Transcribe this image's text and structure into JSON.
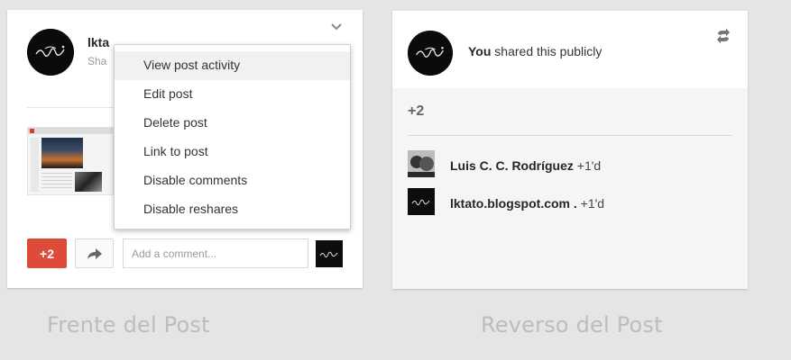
{
  "front": {
    "author_name": "lkta",
    "subtitle": "Sha",
    "menu_items": [
      "View post activity",
      "Edit post",
      "Delete post",
      "Link to post",
      "Disable comments",
      "Disable reshares"
    ],
    "plus_label": "+2",
    "comment_placeholder": "Add a comment..."
  },
  "back": {
    "shared_you": "You",
    "shared_rest": " shared this publicly",
    "plus_count": "+2",
    "plussers": [
      {
        "name": "Luis C. C. Rodríguez",
        "time": "+1'd"
      },
      {
        "name": "lktato.blogspot.com .",
        "time": "+1'd"
      }
    ]
  },
  "captions": {
    "front": "Frente del Post",
    "back": "Reverso del Post"
  },
  "colors": {
    "plus_button": "#dd4b39",
    "background": "#e5e5e5",
    "menu_highlight": "#f1f1f1"
  },
  "icons": {
    "chevron": "chevron-down-icon",
    "share": "share-arrow-icon",
    "reshare": "reshare-icon"
  }
}
